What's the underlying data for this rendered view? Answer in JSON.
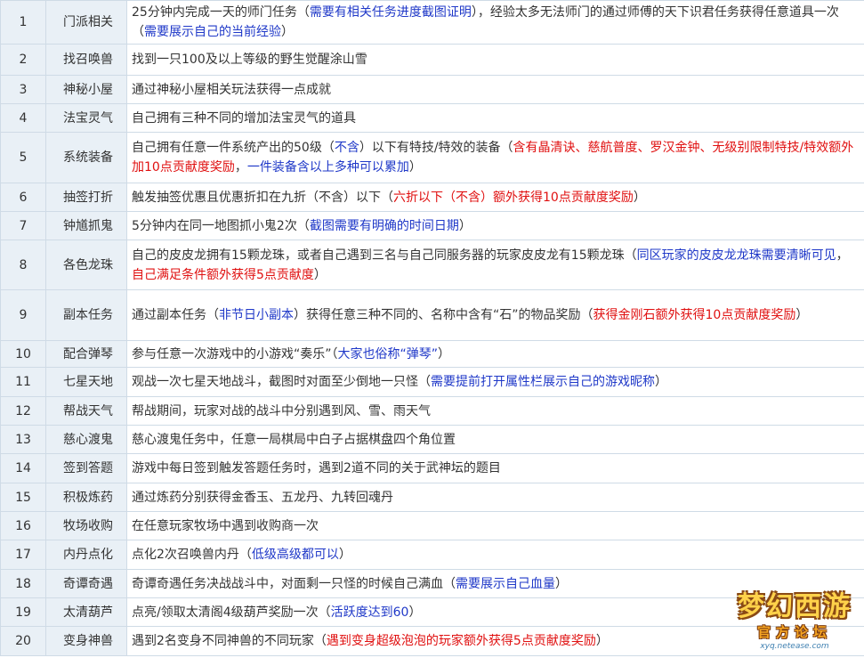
{
  "rows": [
    {
      "num": "1",
      "name": "门派相关",
      "h": 47,
      "desc": [
        {
          "t": "25分钟内完成一天的师门任务（",
          "c": "black"
        },
        {
          "t": "需要有相关任务进度截图证明",
          "c": "blue"
        },
        {
          "t": "），经验太多无法师门的通过师傅的天下识君任务获得任意道具一次（",
          "c": "black"
        },
        {
          "t": "需要展示自己的当前经验",
          "c": "blue"
        },
        {
          "t": "）",
          "c": "black"
        }
      ]
    },
    {
      "num": "2",
      "name": "找召唤兽",
      "h": 35,
      "desc": [
        {
          "t": "找到一只100及以上等级的野生觉醒涂山雪",
          "c": "black"
        }
      ]
    },
    {
      "num": "3",
      "name": "神秘小屋",
      "h": 32,
      "desc": [
        {
          "t": "通过神秘小屋相关玩法获得一点成就",
          "c": "black"
        }
      ]
    },
    {
      "num": "4",
      "name": "法宝灵气",
      "h": 32,
      "desc": [
        {
          "t": "自己拥有三种不同的增加法宝灵气的道具",
          "c": "black"
        }
      ]
    },
    {
      "num": "5",
      "name": "系统装备",
      "h": 57,
      "desc": [
        {
          "t": "自己拥有任意一件系统产出的50级（",
          "c": "black"
        },
        {
          "t": "不含",
          "c": "blue"
        },
        {
          "t": "）以下有特技/特效的装备（",
          "c": "black"
        },
        {
          "t": "含有晶清诀、慈航普度、罗汉金钟、无级别限制特技/特效额外加10点贡献度奖励",
          "c": "red"
        },
        {
          "t": "，",
          "c": "black"
        },
        {
          "t": "一件装备含以上多种可以累加",
          "c": "blue"
        },
        {
          "t": "）",
          "c": "black"
        }
      ]
    },
    {
      "num": "6",
      "name": "抽签打折",
      "h": 32,
      "desc": [
        {
          "t": "触发抽签优惠且优惠折扣在九折（不含）以下（",
          "c": "black"
        },
        {
          "t": "六折以下（不含）",
          "c": "red"
        },
        {
          "t": "额外获得10点贡献度奖励",
          "c": "red"
        },
        {
          "t": "）",
          "c": "black"
        }
      ]
    },
    {
      "num": "7",
      "name": "钟馗抓鬼",
      "h": 32,
      "desc": [
        {
          "t": "5分钟内在同一地图抓小鬼2次（",
          "c": "black"
        },
        {
          "t": "截图需要有明确的时间日期",
          "c": "blue"
        },
        {
          "t": "）",
          "c": "black"
        }
      ]
    },
    {
      "num": "8",
      "name": "各色龙珠",
      "h": 56,
      "desc": [
        {
          "t": "自己的皮皮龙拥有15颗龙珠，或者自己遇到三名与自己同服务器的玩家皮皮龙有15颗龙珠（",
          "c": "black"
        },
        {
          "t": "同区玩家的皮皮龙龙珠需要清晰可见",
          "c": "blue"
        },
        {
          "t": "，",
          "c": "black"
        },
        {
          "t": "自己满足条件额外获得5点贡献度",
          "c": "red"
        },
        {
          "t": "）",
          "c": "black"
        }
      ]
    },
    {
      "num": "9",
      "name": "副本任务",
      "h": 57,
      "desc": [
        {
          "t": "通过副本任务（",
          "c": "black"
        },
        {
          "t": "非节日小副本",
          "c": "blue"
        },
        {
          "t": "）获得任意三种不同的、名称中含有“石”的物品奖励（",
          "c": "black"
        },
        {
          "t": "获得金刚石额外获得10点贡献度奖励",
          "c": "red"
        },
        {
          "t": "）",
          "c": "black"
        }
      ]
    },
    {
      "num": "10",
      "name": "配合弹琴",
      "h": 30,
      "desc": [
        {
          "t": "参与任意一次游戏中的小游戏“奏乐”（",
          "c": "black"
        },
        {
          "t": "大家也俗称“弹琴”",
          "c": "blue"
        },
        {
          "t": "）",
          "c": "black"
        }
      ]
    },
    {
      "num": "11",
      "name": "七星天地",
      "h": 33,
      "desc": [
        {
          "t": "观战一次七星天地战斗，截图时对面至少倒地一只怪（",
          "c": "black"
        },
        {
          "t": "需要提前打开属性栏展示自己的游戏昵称",
          "c": "blue"
        },
        {
          "t": "）",
          "c": "black"
        }
      ]
    },
    {
      "num": "12",
      "name": "帮战天气",
      "h": 32,
      "desc": [
        {
          "t": "帮战期间，玩家对战的战斗中分别遇到风、雪、雨天气",
          "c": "black"
        }
      ]
    },
    {
      "num": "13",
      "name": "慈心渡鬼",
      "h": 32,
      "desc": [
        {
          "t": "慈心渡鬼任务中，任意一局棋局中白子占据棋盘四个角位置",
          "c": "black"
        }
      ]
    },
    {
      "num": "14",
      "name": "签到答题",
      "h": 33,
      "desc": [
        {
          "t": "游戏中每日签到触发答题任务时，遇到2道不同的关于武神坛的题目",
          "c": "black"
        }
      ]
    },
    {
      "num": "15",
      "name": "积极炼药",
      "h": 32,
      "desc": [
        {
          "t": "通过炼药分别获得金香玉、五龙丹、九转回魂丹",
          "c": "black"
        }
      ]
    },
    {
      "num": "16",
      "name": "牧场收购",
      "h": 32,
      "desc": [
        {
          "t": "在任意玩家牧场中遇到收购商一次",
          "c": "black"
        }
      ]
    },
    {
      "num": "17",
      "name": "内丹点化",
      "h": 33,
      "desc": [
        {
          "t": "点化2次召唤兽内丹（",
          "c": "black"
        },
        {
          "t": "低级高级都可以",
          "c": "blue"
        },
        {
          "t": "）",
          "c": "black"
        }
      ]
    },
    {
      "num": "18",
      "name": "奇谭奇遇",
      "h": 32,
      "desc": [
        {
          "t": "奇谭奇遇任务决战战斗中，对面剩一只怪的时候自己满血（",
          "c": "black"
        },
        {
          "t": "需要展示自己血量",
          "c": "blue"
        },
        {
          "t": "）",
          "c": "black"
        }
      ]
    },
    {
      "num": "19",
      "name": "太清葫芦",
      "h": 32,
      "desc": [
        {
          "t": "点亮/领取太清阁4级葫芦奖励一次（",
          "c": "black"
        },
        {
          "t": "活跃度达到60",
          "c": "blue"
        },
        {
          "t": "）",
          "c": "black"
        }
      ]
    },
    {
      "num": "20",
      "name": "变身神兽",
      "h": 33,
      "desc": [
        {
          "t": "遇到2名变身不同神兽的不同玩家（",
          "c": "black"
        },
        {
          "t": "遇到变身超级泡泡的玩家额外获得5点贡献度奖励",
          "c": "red"
        },
        {
          "t": "）",
          "c": "black"
        }
      ]
    }
  ],
  "watermark": {
    "logo": "梦幻西游",
    "sub": "官方论坛",
    "url": "xyq.netease.com"
  }
}
